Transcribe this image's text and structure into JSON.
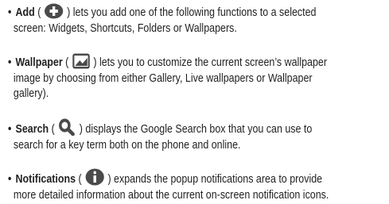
{
  "items": [
    {
      "term": "Add",
      "icon": "plus-circle-icon",
      "lines": [
        ") lets you add one of the following functions to a selected",
        "screen: Widgets, Shortcuts, Folders or Wallpapers."
      ]
    },
    {
      "term": "Wallpaper",
      "icon": "wallpaper-icon",
      "lines": [
        ") lets you to customize the current screen’s wallpaper",
        "image by choosing from either Gallery, Live wallpapers or Wallpaper",
        "gallery)."
      ]
    },
    {
      "term": "Search",
      "icon": "search-icon",
      "lines": [
        ") displays the Google Search box that you can use to",
        "search for a key term both on the phone and online."
      ]
    },
    {
      "term": "Notifications",
      "icon": "notifications-icon",
      "lines": [
        ") expands the popup notifications area to provide",
        "more detailed information about the current on-screen notification icons."
      ]
    }
  ],
  "bullet": "•",
  "open_paren": "(",
  "colors": {
    "icon": "#4a4a4a",
    "text": "#222222"
  }
}
